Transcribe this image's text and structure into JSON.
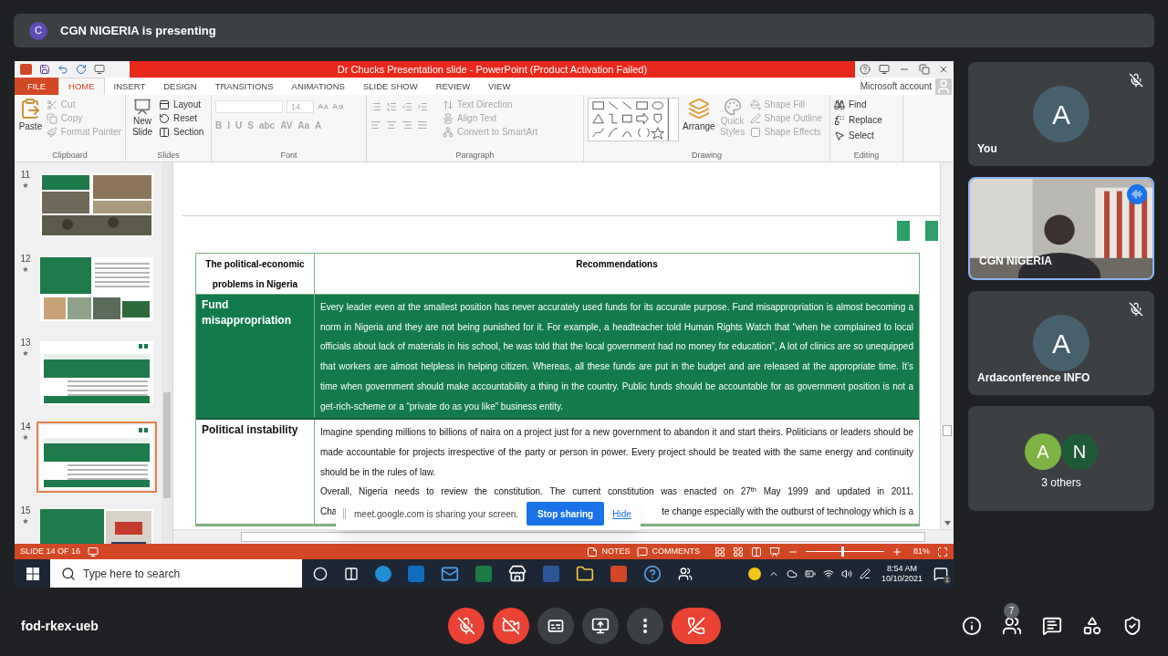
{
  "presenter_banner": {
    "avatar": "C",
    "text": "CGN NIGERIA is presenting"
  },
  "powerpoint": {
    "title": "Dr Chucks Presentation slide - PowerPoint (Product Activation Failed)",
    "account": "Microsoft account",
    "tabs": [
      {
        "label": "FILE",
        "kind": "file",
        "selected": false
      },
      {
        "label": "HOME",
        "kind": "tab",
        "selected": true
      },
      {
        "label": "INSERT",
        "kind": "tab",
        "selected": false
      },
      {
        "label": "DESIGN",
        "kind": "tab",
        "selected": false
      },
      {
        "label": "TRANSITIONS",
        "kind": "tab",
        "selected": false
      },
      {
        "label": "ANIMATIONS",
        "kind": "tab",
        "selected": false
      },
      {
        "label": "SLIDE SHOW",
        "kind": "tab",
        "selected": false
      },
      {
        "label": "REVIEW",
        "kind": "tab",
        "selected": false
      },
      {
        "label": "VIEW",
        "kind": "tab",
        "selected": false
      }
    ],
    "ribbon": {
      "clipboard": {
        "label": "Clipboard",
        "paste": "Paste",
        "items": [
          {
            "label": "Cut",
            "disabled": true
          },
          {
            "label": "Copy",
            "disabled": true
          },
          {
            "label": "Format Painter",
            "disabled": true
          }
        ]
      },
      "slides": {
        "label": "Slides",
        "new_slide": "New Slide",
        "items": [
          {
            "label": "Layout",
            "disabled": false
          },
          {
            "label": "Reset",
            "disabled": false
          },
          {
            "label": "Section",
            "disabled": false
          }
        ]
      },
      "font": {
        "label": "Font",
        "size": "14",
        "formats": [
          "B",
          "I",
          "U",
          "S",
          "abc",
          "AV",
          "Aa",
          "A"
        ]
      },
      "paragraph": {
        "label": "Paragraph",
        "items": [
          {
            "label": "Text Direction",
            "disabled": true
          },
          {
            "label": "Align Text",
            "disabled": true
          },
          {
            "label": "Convert to SmartArt",
            "disabled": true
          }
        ]
      },
      "drawing": {
        "label": "Drawing",
        "arrange": "Arrange",
        "quick_styles": "Quick Styles",
        "items": [
          {
            "label": "Shape Fill",
            "disabled": true
          },
          {
            "label": "Shape Outline",
            "disabled": true
          },
          {
            "label": "Shape Effects",
            "disabled": true
          }
        ]
      },
      "editing": {
        "label": "Editing",
        "items": [
          {
            "label": "Find",
            "disabled": false
          },
          {
            "label": "Replace",
            "disabled": false
          },
          {
            "label": "Select",
            "disabled": false
          }
        ]
      }
    },
    "slides": [
      {
        "number": "11",
        "kind": "photos",
        "selected": false
      },
      {
        "number": "12",
        "kind": "mixed",
        "selected": false
      },
      {
        "number": "13",
        "kind": "table",
        "selected": false
      },
      {
        "number": "14",
        "kind": "table",
        "selected": true
      },
      {
        "number": "15",
        "kind": "text",
        "selected": false
      }
    ],
    "table": {
      "columns": [
        "The political-economic problems in Nigeria",
        "Recommendations"
      ],
      "rows": [
        {
          "problem": "Fund misappropriation",
          "highlighted": true,
          "paragraphs": [
            "Every leader even at the smallest position has never accurately used funds for its accurate purpose. Fund misappropriation is almost becoming a norm in Nigeria and they are not being punished for it. For example, a headteacher told Human Rights Watch that “when he complained to local officials about lack of materials in his school, he was told that the local government had no money for education”, A lot of clinics are so unequipped that workers are almost helpless in helping citizen. Whereas, all these funds are put in the budget and are released at the appropriate time. It’s time when government should make accountability a thing in the country. Public funds should be accountable for as government position is not a get-rich-scheme or a “private do as you like” business entity."
          ]
        },
        {
          "problem": "Political instability",
          "highlighted": false,
          "paragraphs": [
            "Imagine spending millions to billions of naira on a project just for a new government to abandon it and start theirs. Politicians or leaders should be made accountable for projects irrespective of the party or person in power. Every project should be treated with the same energy and continuity should be in the rules of law.",
            "Overall, Nigeria needs to review the constitution. The current constitution was enacted on 27$^{th}$ May 1999 and updated in 2011."
          ],
          "last_line": {
            "start": "Cha",
            "end": "te change especially with the outburst of technology which is a"
          }
        }
      ]
    },
    "status_bar": {
      "slide": "SLIDE 14 OF 16",
      "notes": "NOTES",
      "comments": "COMMENTS",
      "zoom": {
        "level": 0.45,
        "reading": "81%"
      }
    }
  },
  "taskbar": {
    "search_placeholder": "Type here to search",
    "time": "8:54 AM",
    "date": "10/10/2021",
    "notifications": "1"
  },
  "share_notice": {
    "text": "meet.google.com is sharing your screen.",
    "stop": "Stop sharing",
    "hide": "Hide"
  },
  "tiles": [
    {
      "kind": "avatar",
      "name": "You",
      "avatar": "A",
      "muted": true
    },
    {
      "kind": "video",
      "name": "CGN NIGERIA",
      "speaking": true
    },
    {
      "kind": "avatar",
      "name": "Ardaconference INFO",
      "avatar": "A",
      "muted": true
    },
    {
      "kind": "group",
      "name": "3 others",
      "avatars": [
        {
          "letter": "A",
          "color": "#7cb342"
        },
        {
          "letter": "N",
          "color": "#1e5a36"
        }
      ]
    }
  ],
  "meeting_code": "fod-rkex-ueb",
  "controls": [
    {
      "kind": "mic",
      "on": false
    },
    {
      "kind": "camera",
      "on": false
    },
    {
      "kind": "captions",
      "on": false
    },
    {
      "kind": "present"
    },
    {
      "kind": "more"
    },
    {
      "kind": "hangup"
    }
  ],
  "people_count": "7"
}
